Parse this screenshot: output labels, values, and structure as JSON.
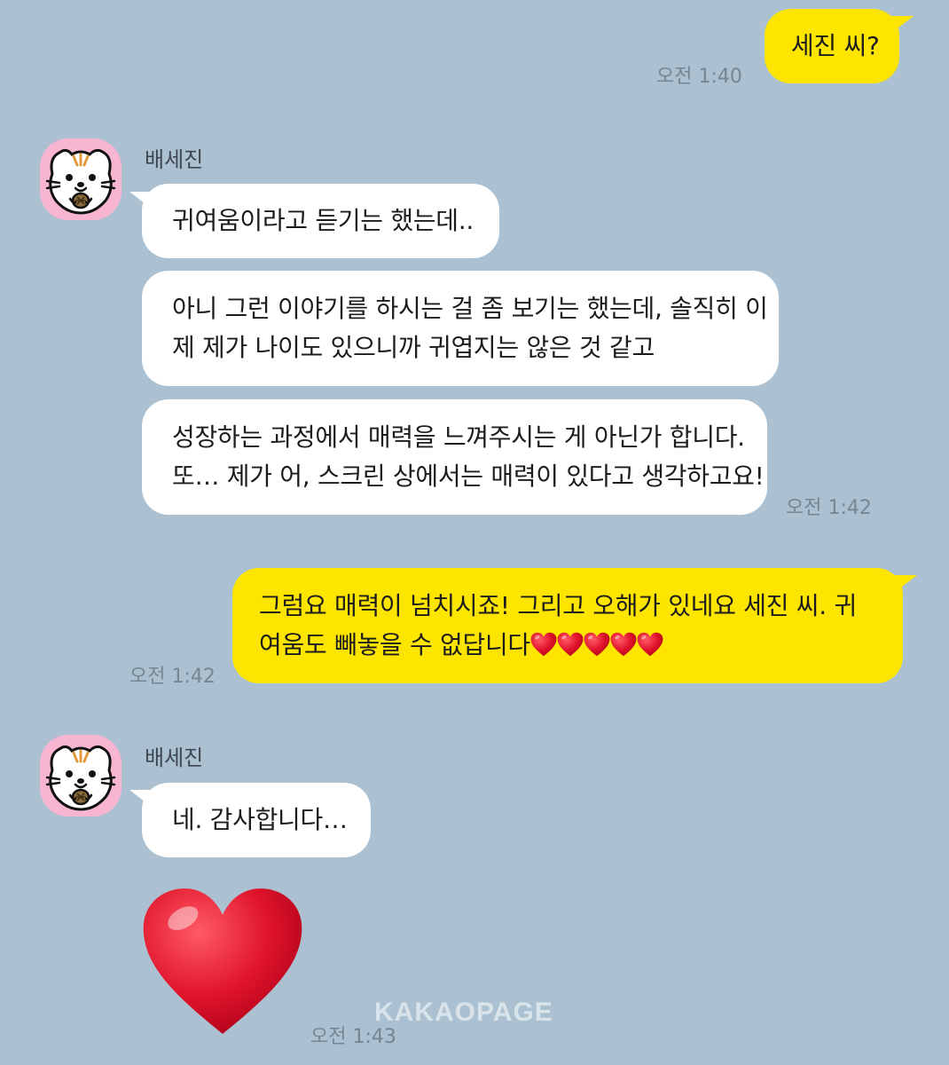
{
  "messages": {
    "m1": {
      "text": "세진 씨?",
      "time": "오전 1:40"
    },
    "m2": {
      "sender": "배세진",
      "text": "귀여움이라고 듣기는 했는데.."
    },
    "m3": {
      "line1": "아니 그런 이야기를 하시는 걸 좀 보기는 했는데, 솔직히 이",
      "line2": "제 제가 나이도 있으니까 귀엽지는 않은 것 같고"
    },
    "m4": {
      "line1": "성장하는 과정에서 매력을 느껴주시는 게 아닌가 합니다.",
      "line2": "또… 제가 어, 스크린 상에서는 매력이 있다고 생각하고요!",
      "time": "오전 1:42"
    },
    "m5": {
      "line1": "그럼요 매력이 넘치시죠! 그리고 오해가 있네요 세진 씨. 귀",
      "line2": "여움도 빼놓을 수 없답니다",
      "time": "오전 1:42"
    },
    "m6": {
      "sender": "배세진",
      "text": "네. 감사합니다…"
    },
    "m7": {
      "emoji": "red-heart",
      "time": "오전 1:43"
    }
  },
  "watermark": "KAKAOPAGE",
  "colors": {
    "background": "#abc1d1",
    "my_bubble": "#fee500",
    "their_bubble": "#ffffff",
    "avatar_bg": "#f8b5d2",
    "heart": "#e0142a"
  }
}
